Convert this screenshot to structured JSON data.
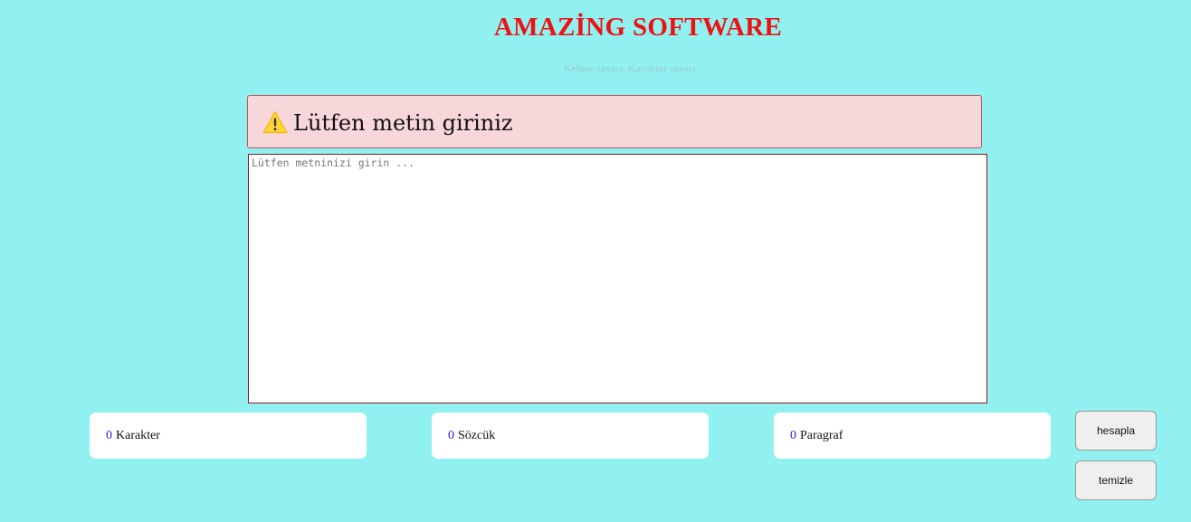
{
  "header": {
    "title": "AMAZİNG SOFTWARE",
    "subtitle": "Kelime sayacı, Karakter sayacı"
  },
  "alert": {
    "icon": "warning-icon",
    "text": "Lütfen metin giriniz",
    "background": "#f8d7da"
  },
  "editor": {
    "value": "",
    "placeholder": "Lütfen metninizi girin ..."
  },
  "stats": {
    "characters": {
      "count": "0",
      "label": "Karakter"
    },
    "words": {
      "count": "0",
      "label": "Sözcük"
    },
    "paragraphs": {
      "count": "0",
      "label": "Paragraf"
    }
  },
  "buttons": {
    "calculate": "hesapla",
    "clear": "temizle"
  },
  "colors": {
    "page_background": "#91f1f0",
    "title": "#ee1111",
    "count": "#2424d4"
  }
}
